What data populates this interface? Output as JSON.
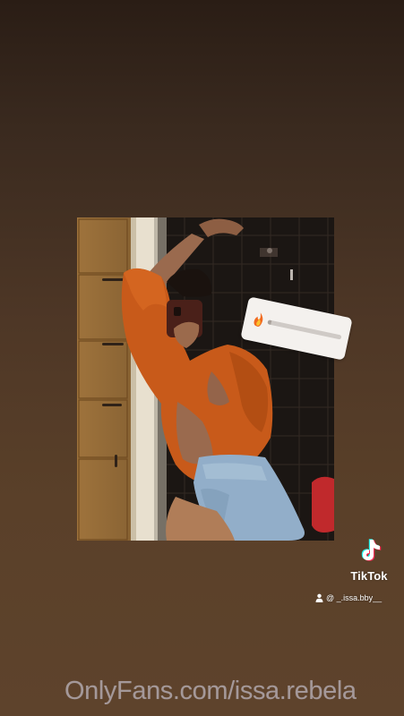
{
  "tiktok": {
    "wordmark": "TikTok",
    "handle": "@ _.issa.bby__"
  },
  "watermark": {
    "text": "OnlyFans.com/issa.rebela"
  },
  "slider_sticker": {
    "emoji": "fire-emoji",
    "value": 0.05
  },
  "icons": {
    "tiktok": "tiktok-note-icon",
    "user": "user-icon"
  },
  "colors": {
    "background_top": "#2a1d15",
    "background_bottom": "#5e432c",
    "sweater": "#c85a1a",
    "sticker": "#f4f1ee",
    "watermark": "#c4bfcd"
  }
}
